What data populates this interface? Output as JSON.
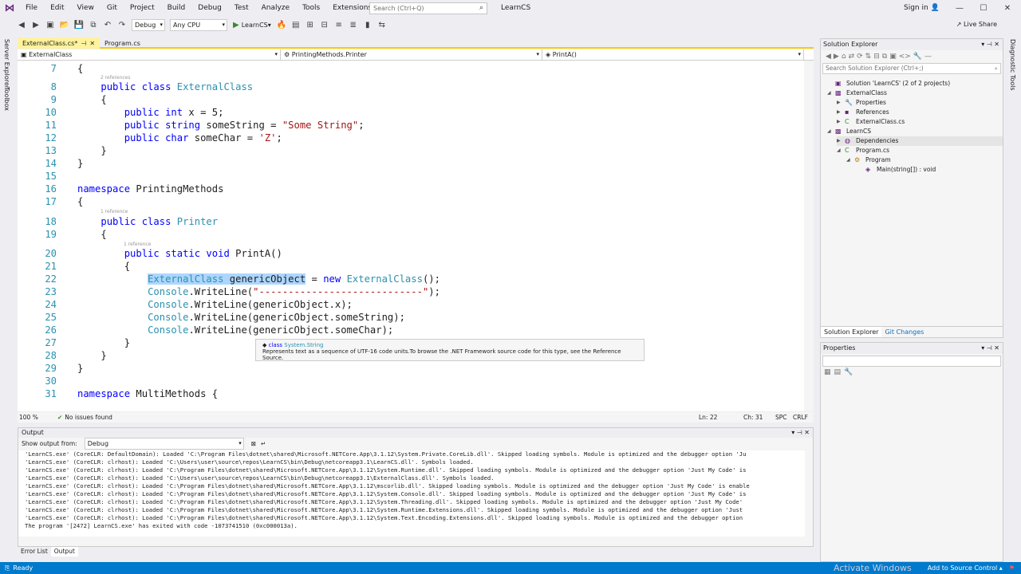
{
  "menu": [
    "File",
    "Edit",
    "View",
    "Git",
    "Project",
    "Build",
    "Debug",
    "Test",
    "Analyze",
    "Tools",
    "Extensions",
    "Window",
    "Help"
  ],
  "search_placeholder": "Search (Ctrl+Q)",
  "solution_title": "LearnCS",
  "signin": "Sign in",
  "toolbar": {
    "config": "Debug",
    "platform": "Any CPU",
    "run_label": "LearnCS",
    "liveshare": "Live Share"
  },
  "side_labels": {
    "server_explorer": "Server Explorer",
    "toolbox": "Toolbox",
    "diagnostic_tools": "Diagnostic Tools"
  },
  "tabs": [
    {
      "label": "ExternalClass.cs*"
    },
    {
      "label": "Program.cs"
    }
  ],
  "navbar": {
    "project": "ExternalClass",
    "type": "PrintingMethods.Printer",
    "member": "PrintA()"
  },
  "code_lines": [
    {
      "n": "7",
      "parts": [
        [
          "p",
          "{"
        ]
      ]
    },
    {
      "n": "8",
      "parts": [
        [
          "p",
          "    "
        ],
        [
          "kw",
          "public class "
        ],
        [
          "ty",
          "ExternalClass"
        ]
      ]
    },
    {
      "n": "9",
      "parts": [
        [
          "p",
          "    {"
        ]
      ]
    },
    {
      "n": "10",
      "parts": [
        [
          "p",
          "        "
        ],
        [
          "kw",
          "public int"
        ],
        [
          "p",
          " x = 5;"
        ]
      ]
    },
    {
      "n": "11",
      "parts": [
        [
          "p",
          "        "
        ],
        [
          "kw",
          "public string"
        ],
        [
          "p",
          " someString = "
        ],
        [
          "str",
          "\"Some String\""
        ],
        [
          "p",
          ";"
        ]
      ]
    },
    {
      "n": "12",
      "parts": [
        [
          "p",
          "        "
        ],
        [
          "kw",
          "public char"
        ],
        [
          "p",
          " someChar = "
        ],
        [
          "str",
          "'Z'"
        ],
        [
          "p",
          ";"
        ]
      ]
    },
    {
      "n": "13",
      "parts": [
        [
          "p",
          "    }"
        ]
      ]
    },
    {
      "n": "14",
      "parts": [
        [
          "p",
          "}"
        ]
      ]
    },
    {
      "n": "15",
      "parts": [
        [
          "p",
          ""
        ]
      ]
    },
    {
      "n": "16",
      "parts": [
        [
          "kw",
          "namespace"
        ],
        [
          "p",
          " PrintingMethods"
        ]
      ]
    },
    {
      "n": "17",
      "parts": [
        [
          "p",
          "{"
        ]
      ]
    },
    {
      "n": "18",
      "parts": [
        [
          "p",
          "    "
        ],
        [
          "kw",
          "public class "
        ],
        [
          "ty",
          "Printer"
        ]
      ]
    },
    {
      "n": "19",
      "parts": [
        [
          "p",
          "    {"
        ]
      ]
    },
    {
      "n": "20",
      "parts": [
        [
          "p",
          "        "
        ],
        [
          "kw",
          "public static void"
        ],
        [
          "p",
          " PrintA()"
        ]
      ]
    },
    {
      "n": "21",
      "parts": [
        [
          "p",
          "        {"
        ]
      ]
    },
    {
      "n": "22",
      "parts": [
        [
          "p",
          "            "
        ],
        [
          "hlty",
          "ExternalClass "
        ],
        [
          "hl",
          "genericObject"
        ],
        [
          "p",
          " = "
        ],
        [
          "kw",
          "new "
        ],
        [
          "ty",
          "ExternalClass"
        ],
        [
          "p",
          "();"
        ]
      ]
    },
    {
      "n": "23",
      "parts": [
        [
          "p",
          "            "
        ],
        [
          "ty",
          "Console"
        ],
        [
          "p",
          ".WriteLine("
        ],
        [
          "str",
          "\"----------------------------\""
        ],
        [
          "p",
          ");"
        ]
      ]
    },
    {
      "n": "24",
      "parts": [
        [
          "p",
          "            "
        ],
        [
          "ty",
          "Console"
        ],
        [
          "p",
          ".WriteLine(genericObject.x);"
        ]
      ]
    },
    {
      "n": "25",
      "parts": [
        [
          "p",
          "            "
        ],
        [
          "ty",
          "Console"
        ],
        [
          "p",
          ".WriteLine(genericObject.someString);"
        ]
      ]
    },
    {
      "n": "26",
      "parts": [
        [
          "p",
          "            "
        ],
        [
          "ty",
          "Console"
        ],
        [
          "p",
          ".WriteLine(genericObject.someChar);"
        ]
      ]
    },
    {
      "n": "27",
      "parts": [
        [
          "p",
          "        }"
        ]
      ]
    },
    {
      "n": "28",
      "parts": [
        [
          "p",
          "    }"
        ]
      ]
    },
    {
      "n": "29",
      "parts": [
        [
          "p",
          "}"
        ]
      ]
    },
    {
      "n": "30",
      "parts": [
        [
          "p",
          ""
        ]
      ]
    },
    {
      "n": "31",
      "parts": [
        [
          "kw",
          "namespace"
        ],
        [
          "p",
          " MultiMethods {"
        ]
      ]
    }
  ],
  "references": {
    "r2": "2 references",
    "r1": "1 reference"
  },
  "tooltip": {
    "kind": "class",
    "name": "System.String",
    "desc": "Represents text as a sequence of UTF-16 code units.To browse the .NET Framework source code for this type, see the Reference Source."
  },
  "editor_status": {
    "zoom": "100 %",
    "issues": "No issues found",
    "ln": "Ln: 22",
    "ch": "Ch: 31",
    "spc": "SPC",
    "crlf": "CRLF"
  },
  "solution_explorer": {
    "title": "Solution Explorer",
    "search": "Search Solution Explorer (Ctrl+;)",
    "items": [
      {
        "label": "Solution 'LearnCS' (2 of 2 projects)",
        "icon": "solution-icon"
      },
      {
        "label": "ExternalClass",
        "icon": "project-icon"
      },
      {
        "label": "Properties",
        "icon": "wrench-icon"
      },
      {
        "label": "References",
        "icon": "references-icon"
      },
      {
        "label": "ExternalClass.cs",
        "icon": "csharp-file-icon"
      },
      {
        "label": "LearnCS",
        "icon": "project-icon"
      },
      {
        "label": "Dependencies",
        "icon": "dependencies-icon"
      },
      {
        "label": "Program.cs",
        "icon": "csharp-file-icon"
      },
      {
        "label": "Program",
        "icon": "class-icon"
      },
      {
        "label": "Main(string[]) : void",
        "icon": "method-icon"
      }
    ],
    "tabs": [
      "Solution Explorer",
      "Git Changes"
    ]
  },
  "properties_title": "Properties",
  "output": {
    "title": "Output",
    "show_from_label": "Show output from:",
    "show_from_value": "Debug",
    "lines": [
      "'LearnCS.exe' (CoreCLR: DefaultDomain): Loaded 'C:\\Program Files\\dotnet\\shared\\Microsoft.NETCore.App\\3.1.12\\System.Private.CoreLib.dll'. Skipped loading symbols. Module is optimized and the debugger option 'Ju",
      "'LearnCS.exe' (CoreCLR: clrhost): Loaded 'C:\\Users\\user\\source\\repos\\LearnCS\\bin\\Debug\\netcoreapp3.1\\LearnCS.dll'. Symbols loaded.",
      "'LearnCS.exe' (CoreCLR: clrhost): Loaded 'C:\\Program Files\\dotnet\\shared\\Microsoft.NETCore.App\\3.1.12\\System.Runtime.dll'. Skipped loading symbols. Module is optimized and the debugger option 'Just My Code' is",
      "'LearnCS.exe' (CoreCLR: clrhost): Loaded 'C:\\Users\\user\\source\\repos\\LearnCS\\bin\\Debug\\netcoreapp3.1\\ExternalClass.dll'. Symbols loaded.",
      "'LearnCS.exe' (CoreCLR: clrhost): Loaded 'C:\\Program Files\\dotnet\\shared\\Microsoft.NETCore.App\\3.1.12\\mscorlib.dll'. Skipped loading symbols. Module is optimized and the debugger option 'Just My Code' is enable",
      "'LearnCS.exe' (CoreCLR: clrhost): Loaded 'C:\\Program Files\\dotnet\\shared\\Microsoft.NETCore.App\\3.1.12\\System.Console.dll'. Skipped loading symbols. Module is optimized and the debugger option 'Just My Code' is",
      "'LearnCS.exe' (CoreCLR: clrhost): Loaded 'C:\\Program Files\\dotnet\\shared\\Microsoft.NETCore.App\\3.1.12\\System.Threading.dll'. Skipped loading symbols. Module is optimized and the debugger option 'Just My Code'",
      "'LearnCS.exe' (CoreCLR: clrhost): Loaded 'C:\\Program Files\\dotnet\\shared\\Microsoft.NETCore.App\\3.1.12\\System.Runtime.Extensions.dll'. Skipped loading symbols. Module is optimized and the debugger option 'Just",
      "'LearnCS.exe' (CoreCLR: clrhost): Loaded 'C:\\Program Files\\dotnet\\shared\\Microsoft.NETCore.App\\3.1.12\\System.Text.Encoding.Extensions.dll'. Skipped loading symbols. Module is optimized and the debugger option",
      "The program '[2472] LearnCS.exe' has exited with code -1073741510 (0xc000013a)."
    ]
  },
  "bottom_tabs": [
    "Error List",
    "Output"
  ],
  "status": {
    "ready": "Ready",
    "source_control": "Add to Source Control",
    "watermark": "Activate Windows"
  },
  "colors": {
    "accent": "#007acc",
    "keyword": "#0000ff",
    "type": "#2b91af",
    "string": "#a31515",
    "highlight": "#add6ff",
    "tab_active": "#fff29d"
  }
}
